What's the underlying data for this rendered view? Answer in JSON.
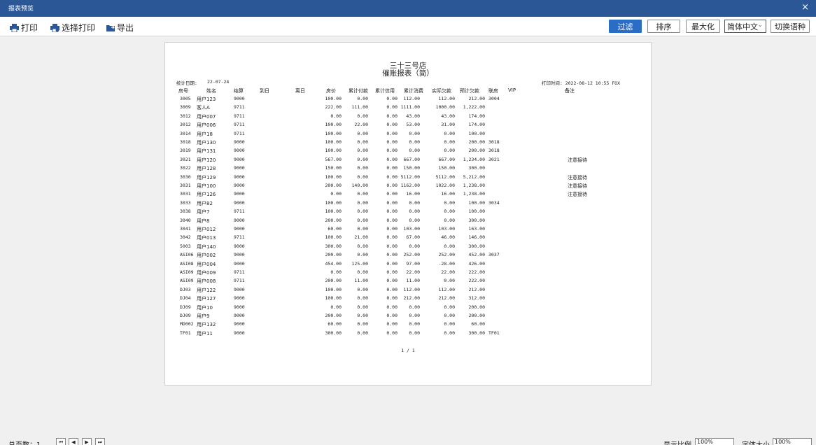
{
  "window": {
    "title": "报表预览",
    "close": "×"
  },
  "toolbar": {
    "print": "打印",
    "select_print": "选择打印",
    "export": "导出",
    "filter": "过滤",
    "sort": "排序",
    "maximize": "最大化",
    "language_value": "简体中文",
    "switch_language": "切换语种"
  },
  "report": {
    "shop": "三十三号店",
    "title": "催账报表（简）",
    "stat_date_label": "统计日期:",
    "stat_date": "22-07-24",
    "print_time": "打印时间: 2022-08-12 10:55 FOX",
    "headers": [
      "房号",
      "姓名",
      "结算",
      "到日",
      "离日",
      "房价",
      "累计付款",
      "累计信用",
      "累计消费",
      "实际欠款",
      "预计欠款",
      "联房",
      "VIP",
      "备注"
    ],
    "rows": [
      [
        "3005",
        "用户123",
        "9000",
        "",
        "",
        "100.00",
        "0.00",
        "0.00",
        "112.00",
        "112.00",
        "212.00",
        "3004",
        "",
        ""
      ],
      [
        "3009",
        "客人A",
        "9711",
        "",
        "",
        "222.00",
        "111.00",
        "0.00",
        "1111.00",
        "1000.00",
        "1,222.00",
        "",
        "",
        ""
      ],
      [
        "3012",
        "用户007",
        "9711",
        "",
        "",
        "0.00",
        "0.00",
        "0.00",
        "43.00",
        "43.00",
        "174.00",
        "",
        "",
        ""
      ],
      [
        "3012",
        "用户006",
        "9711",
        "",
        "",
        "100.00",
        "22.00",
        "0.00",
        "53.00",
        "31.00",
        "174.00",
        "",
        "",
        ""
      ],
      [
        "3014",
        "用户18",
        "9711",
        "",
        "",
        "100.00",
        "0.00",
        "0.00",
        "0.00",
        "0.00",
        "100.00",
        "",
        "",
        ""
      ],
      [
        "3018",
        "用户130",
        "9000",
        "",
        "",
        "100.00",
        "0.00",
        "0.00",
        "0.00",
        "0.00",
        "200.00",
        "3018",
        "",
        ""
      ],
      [
        "3019",
        "用户131",
        "9000",
        "",
        "",
        "100.00",
        "0.00",
        "0.00",
        "0.00",
        "0.00",
        "200.00",
        "3018",
        "",
        ""
      ],
      [
        "3021",
        "用户120",
        "9000",
        "",
        "",
        "567.00",
        "0.00",
        "0.00",
        "667.00",
        "667.00",
        "1,234.00",
        "3021",
        "",
        "注意接待"
      ],
      [
        "3022",
        "用户128",
        "9000",
        "",
        "",
        "150.00",
        "0.00",
        "0.00",
        "150.00",
        "150.00",
        "300.00",
        "",
        "",
        ""
      ],
      [
        "3030",
        "用户129",
        "9000",
        "",
        "",
        "100.00",
        "0.00",
        "0.00",
        "5112.00",
        "5112.00",
        "5,212.00",
        "",
        "",
        "注意接待"
      ],
      [
        "3031",
        "用户100",
        "9000",
        "",
        "",
        "200.00",
        "140.00",
        "0.00",
        "1162.00",
        "1022.00",
        "1,238.00",
        "",
        "",
        "注意接待"
      ],
      [
        "3031",
        "用户126",
        "9000",
        "",
        "",
        "0.00",
        "0.00",
        "0.00",
        "16.00",
        "16.00",
        "1,238.00",
        "",
        "",
        "注意接待"
      ],
      [
        "3033",
        "用户82",
        "9000",
        "",
        "",
        "100.00",
        "0.00",
        "0.00",
        "0.00",
        "0.00",
        "100.00",
        "3034",
        "",
        ""
      ],
      [
        "3038",
        "用户7",
        "9711",
        "",
        "",
        "100.00",
        "0.00",
        "0.00",
        "0.00",
        "0.00",
        "100.00",
        "",
        "",
        ""
      ],
      [
        "3040",
        "用户8",
        "9000",
        "",
        "",
        "200.00",
        "0.00",
        "0.00",
        "0.00",
        "0.00",
        "300.00",
        "",
        "",
        ""
      ],
      [
        "3041",
        "用户012",
        "9000",
        "",
        "",
        "60.00",
        "0.00",
        "0.00",
        "103.00",
        "103.00",
        "163.00",
        "",
        "",
        ""
      ],
      [
        "3042",
        "用户013",
        "9711",
        "",
        "",
        "100.00",
        "21.00",
        "0.00",
        "67.00",
        "46.00",
        "146.00",
        "",
        "",
        ""
      ],
      [
        "5003",
        "用户140",
        "9000",
        "",
        "",
        "300.00",
        "0.00",
        "0.00",
        "0.00",
        "0.00",
        "300.00",
        "",
        "",
        ""
      ],
      [
        "ASI06",
        "用户002",
        "9000",
        "",
        "",
        "200.00",
        "0.00",
        "0.00",
        "252.00",
        "252.00",
        "452.00",
        "3037",
        "",
        ""
      ],
      [
        "ASI08",
        "用户004",
        "9000",
        "",
        "",
        "454.00",
        "125.00",
        "0.00",
        "97.00",
        "-28.00",
        "426.00",
        "",
        "",
        ""
      ],
      [
        "ASI09",
        "用户009",
        "9711",
        "",
        "",
        "0.00",
        "0.00",
        "0.00",
        "22.00",
        "22.00",
        "222.00",
        "",
        "",
        ""
      ],
      [
        "ASI09",
        "用户008",
        "9711",
        "",
        "",
        "200.00",
        "11.00",
        "0.00",
        "11.00",
        "0.00",
        "222.00",
        "",
        "",
        ""
      ],
      [
        "DJ03",
        "用户122",
        "9000",
        "",
        "",
        "100.00",
        "0.00",
        "0.00",
        "112.00",
        "112.00",
        "212.00",
        "",
        "",
        ""
      ],
      [
        "DJ04",
        "用户127",
        "9000",
        "",
        "",
        "100.00",
        "0.00",
        "0.00",
        "212.00",
        "212.00",
        "312.00",
        "",
        "",
        ""
      ],
      [
        "DJ09",
        "用户10",
        "9000",
        "",
        "",
        "0.00",
        "0.00",
        "0.00",
        "0.00",
        "0.00",
        "200.00",
        "",
        "",
        ""
      ],
      [
        "DJ09",
        "用户9",
        "9000",
        "",
        "",
        "200.00",
        "0.00",
        "0.00",
        "0.00",
        "0.00",
        "200.00",
        "",
        "",
        ""
      ],
      [
        "MD002",
        "用户132",
        "9000",
        "",
        "",
        "60.00",
        "0.00",
        "0.00",
        "0.00",
        "0.00",
        "60.00",
        "",
        "",
        ""
      ],
      [
        "TF01",
        "用户11",
        "9000",
        "",
        "",
        "300.00",
        "0.00",
        "0.00",
        "0.00",
        "0.00",
        "300.00",
        "TF01",
        "",
        ""
      ]
    ],
    "page": "1 / 1"
  },
  "status": {
    "total_pages": "总页数：1",
    "scale_label": "显示比例",
    "scale_value": "100%",
    "font_label": "字体大小",
    "font_value": "100%"
  }
}
